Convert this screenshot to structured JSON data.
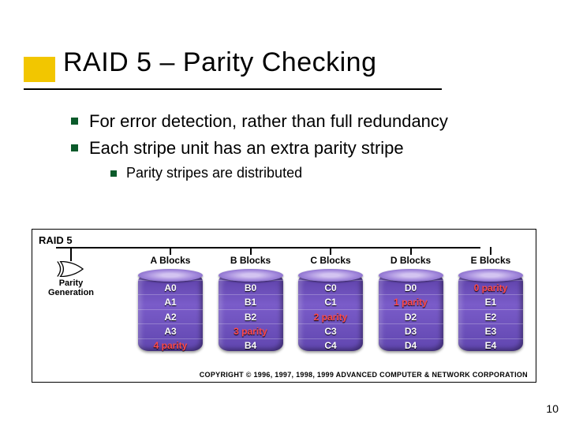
{
  "title": "RAID 5 – Parity Checking",
  "bullets": [
    "For error detection, rather than full redundancy",
    "Each stripe unit has an extra parity stripe"
  ],
  "sub_bullets": [
    "Parity stripes are distributed"
  ],
  "diagram": {
    "label": "RAID 5",
    "parity_label": [
      "Parity",
      "Generation"
    ],
    "columns": [
      {
        "header": "A Blocks",
        "cells": [
          {
            "text": "A0",
            "parity": false
          },
          {
            "text": "A1",
            "parity": false
          },
          {
            "text": "A2",
            "parity": false
          },
          {
            "text": "A3",
            "parity": false
          },
          {
            "text": "4 parity",
            "parity": true
          }
        ]
      },
      {
        "header": "B Blocks",
        "cells": [
          {
            "text": "B0",
            "parity": false
          },
          {
            "text": "B1",
            "parity": false
          },
          {
            "text": "B2",
            "parity": false
          },
          {
            "text": "3 parity",
            "parity": true
          },
          {
            "text": "B4",
            "parity": false
          }
        ]
      },
      {
        "header": "C Blocks",
        "cells": [
          {
            "text": "C0",
            "parity": false
          },
          {
            "text": "C1",
            "parity": false
          },
          {
            "text": "2 parity",
            "parity": true
          },
          {
            "text": "C3",
            "parity": false
          },
          {
            "text": "C4",
            "parity": false
          }
        ]
      },
      {
        "header": "D Blocks",
        "cells": [
          {
            "text": "D0",
            "parity": false
          },
          {
            "text": "1 parity",
            "parity": true
          },
          {
            "text": "D2",
            "parity": false
          },
          {
            "text": "D3",
            "parity": false
          },
          {
            "text": "D4",
            "parity": false
          }
        ]
      },
      {
        "header": "E Blocks",
        "cells": [
          {
            "text": "0 parity",
            "parity": true
          },
          {
            "text": "E1",
            "parity": false
          },
          {
            "text": "E2",
            "parity": false
          },
          {
            "text": "E3",
            "parity": false
          },
          {
            "text": "E4",
            "parity": false
          }
        ]
      }
    ],
    "copyright": "COPYRIGHT © 1996, 1997, 1998, 1999 ADVANCED COMPUTER & NETWORK CORPORATION"
  },
  "page_number": "10"
}
